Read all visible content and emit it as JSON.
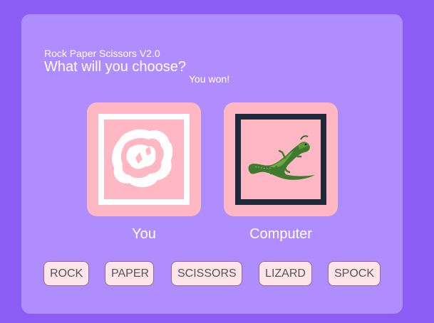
{
  "header": {
    "title": "Rock Paper Scissors V2.0",
    "prompt": "What will you choose?",
    "result": "You won!"
  },
  "players": {
    "you": {
      "label": "You",
      "choice_icon": "rock-icon",
      "frame_color": "#ffffff"
    },
    "computer": {
      "label": "Computer",
      "choice_icon": "lizard-icon",
      "frame_color": "#1e2a3a"
    }
  },
  "choices": [
    "ROCK",
    "PAPER",
    "SCISSORS",
    "LIZARD",
    "SPOCK"
  ],
  "colors": {
    "page_background": "#8b5cf6",
    "card_background": "#b08dff",
    "tile_background": "#ffb8c3",
    "button_background": "#ffe4ea"
  }
}
